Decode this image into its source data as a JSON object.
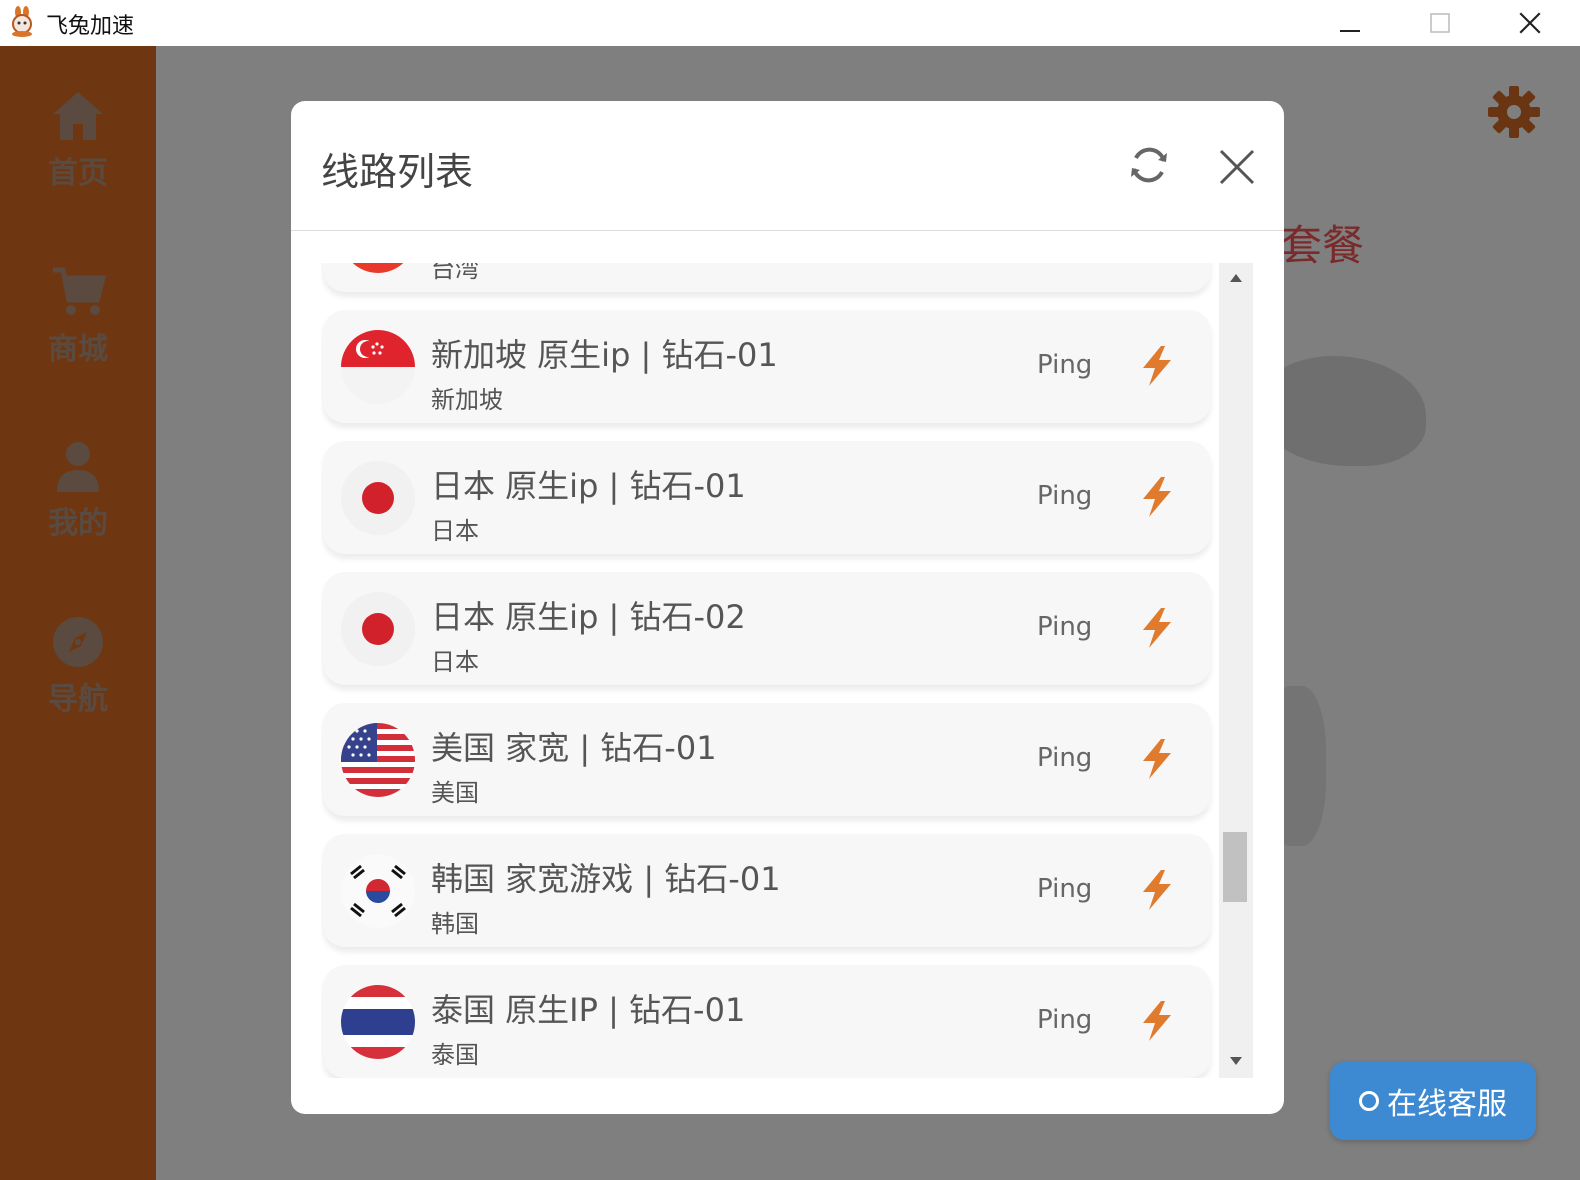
{
  "window": {
    "title": "飞兔加速"
  },
  "sidebar": {
    "items": [
      {
        "label": "首页",
        "icon": "home-icon"
      },
      {
        "label": "商城",
        "icon": "cart-icon"
      },
      {
        "label": "我的",
        "icon": "user-icon"
      },
      {
        "label": "导航",
        "icon": "compass-icon"
      }
    ]
  },
  "background": {
    "partial_text": "套餐"
  },
  "modal": {
    "title": "线路列表",
    "ping_label": "Ping",
    "rows": [
      {
        "name": "",
        "region": "台湾",
        "flag": "taiwan-flag-icon"
      },
      {
        "name": "新加坡 原生ip | 钻石-01",
        "region": "新加坡",
        "flag": "singapore-flag-icon"
      },
      {
        "name": "日本 原生ip | 钻石-01",
        "region": "日本",
        "flag": "japan-flag-icon"
      },
      {
        "name": "日本 原生ip | 钻石-02",
        "region": "日本",
        "flag": "japan-flag-icon"
      },
      {
        "name": "美国 家宽 | 钻石-01",
        "region": "美国",
        "flag": "usa-flag-icon"
      },
      {
        "name": "韩国 家宽游戏 | 钻石-01",
        "region": "韩国",
        "flag": "korea-flag-icon"
      },
      {
        "name": "泰国 原生IP | 钻石-01",
        "region": "泰国",
        "flag": "thailand-flag-icon"
      }
    ]
  },
  "service_button": {
    "label": "在线客服"
  },
  "colors": {
    "sidebar": "#6e3712",
    "accent_orange": "#e07a2c",
    "service_blue": "#3d8ad3"
  }
}
